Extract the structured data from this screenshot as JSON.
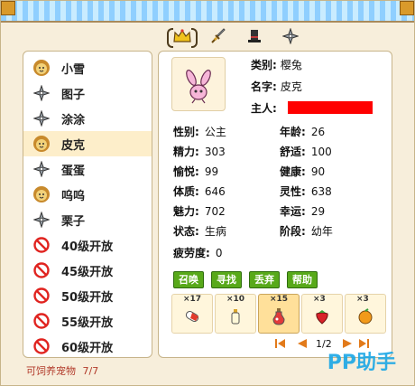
{
  "tabs": [
    {
      "icon": "crown-icon",
      "active": true
    },
    {
      "icon": "sword-icon",
      "active": false
    },
    {
      "icon": "hat-icon",
      "active": false
    },
    {
      "icon": "shuriken-icon",
      "active": false
    }
  ],
  "pet_list": [
    {
      "icon": "lion-face-icon",
      "name": "小雪",
      "selected": false
    },
    {
      "icon": "shuriken-icon",
      "name": "图子",
      "selected": false
    },
    {
      "icon": "shuriken-icon",
      "name": "涂涂",
      "selected": false
    },
    {
      "icon": "lion-face-icon",
      "name": "皮克",
      "selected": true
    },
    {
      "icon": "shuriken-icon",
      "name": "蛋蛋",
      "selected": false
    },
    {
      "icon": "lion-face-icon",
      "name": "呜呜",
      "selected": false
    },
    {
      "icon": "shuriken-icon",
      "name": "栗子",
      "selected": false
    },
    {
      "icon": "no-entry-icon",
      "name": "40级开放",
      "selected": false
    },
    {
      "icon": "no-entry-icon",
      "name": "45级开放",
      "selected": false
    },
    {
      "icon": "no-entry-icon",
      "name": "50级开放",
      "selected": false
    },
    {
      "icon": "no-entry-icon",
      "name": "55级开放",
      "selected": false
    },
    {
      "icon": "no-entry-icon",
      "name": "60级开放",
      "selected": false
    }
  ],
  "footer": {
    "label": "可饲养宠物",
    "count": "7/7"
  },
  "detail": {
    "category_label": "类别:",
    "category_value": "樱兔",
    "name_label": "名字:",
    "name_value": "皮克",
    "owner_label": "主人:",
    "stats": [
      {
        "label": "性别:",
        "value": "公主"
      },
      {
        "label": "年龄:",
        "value": "26"
      },
      {
        "label": "精力:",
        "value": "303"
      },
      {
        "label": "舒适:",
        "value": "100"
      },
      {
        "label": "愉悦:",
        "value": "99"
      },
      {
        "label": "健康:",
        "value": "90"
      },
      {
        "label": "体质:",
        "value": "646"
      },
      {
        "label": "灵性:",
        "value": "638"
      },
      {
        "label": "魅力:",
        "value": "702"
      },
      {
        "label": "幸运:",
        "value": "29"
      },
      {
        "label": "状态:",
        "value": "生病"
      },
      {
        "label": "阶段:",
        "value": "幼年"
      },
      {
        "label": "疲劳度:",
        "value": "0"
      }
    ],
    "buttons": [
      "召唤",
      "寻找",
      "丢弃",
      "帮助"
    ],
    "items": [
      {
        "icon": "capsule-icon",
        "qty": "×17",
        "selected": false
      },
      {
        "icon": "bottle-icon",
        "qty": "×10",
        "selected": false
      },
      {
        "icon": "potion-icon",
        "qty": "×15",
        "selected": true
      },
      {
        "icon": "strawberry-icon",
        "qty": "×3",
        "selected": false
      },
      {
        "icon": "orange-icon",
        "qty": "×3",
        "selected": false
      }
    ],
    "page": "1/2"
  },
  "watermark": "PP助手",
  "colors": {
    "accent": "#58a91a",
    "redaction": "#ff0000",
    "footer_text": "#b23a2a"
  }
}
